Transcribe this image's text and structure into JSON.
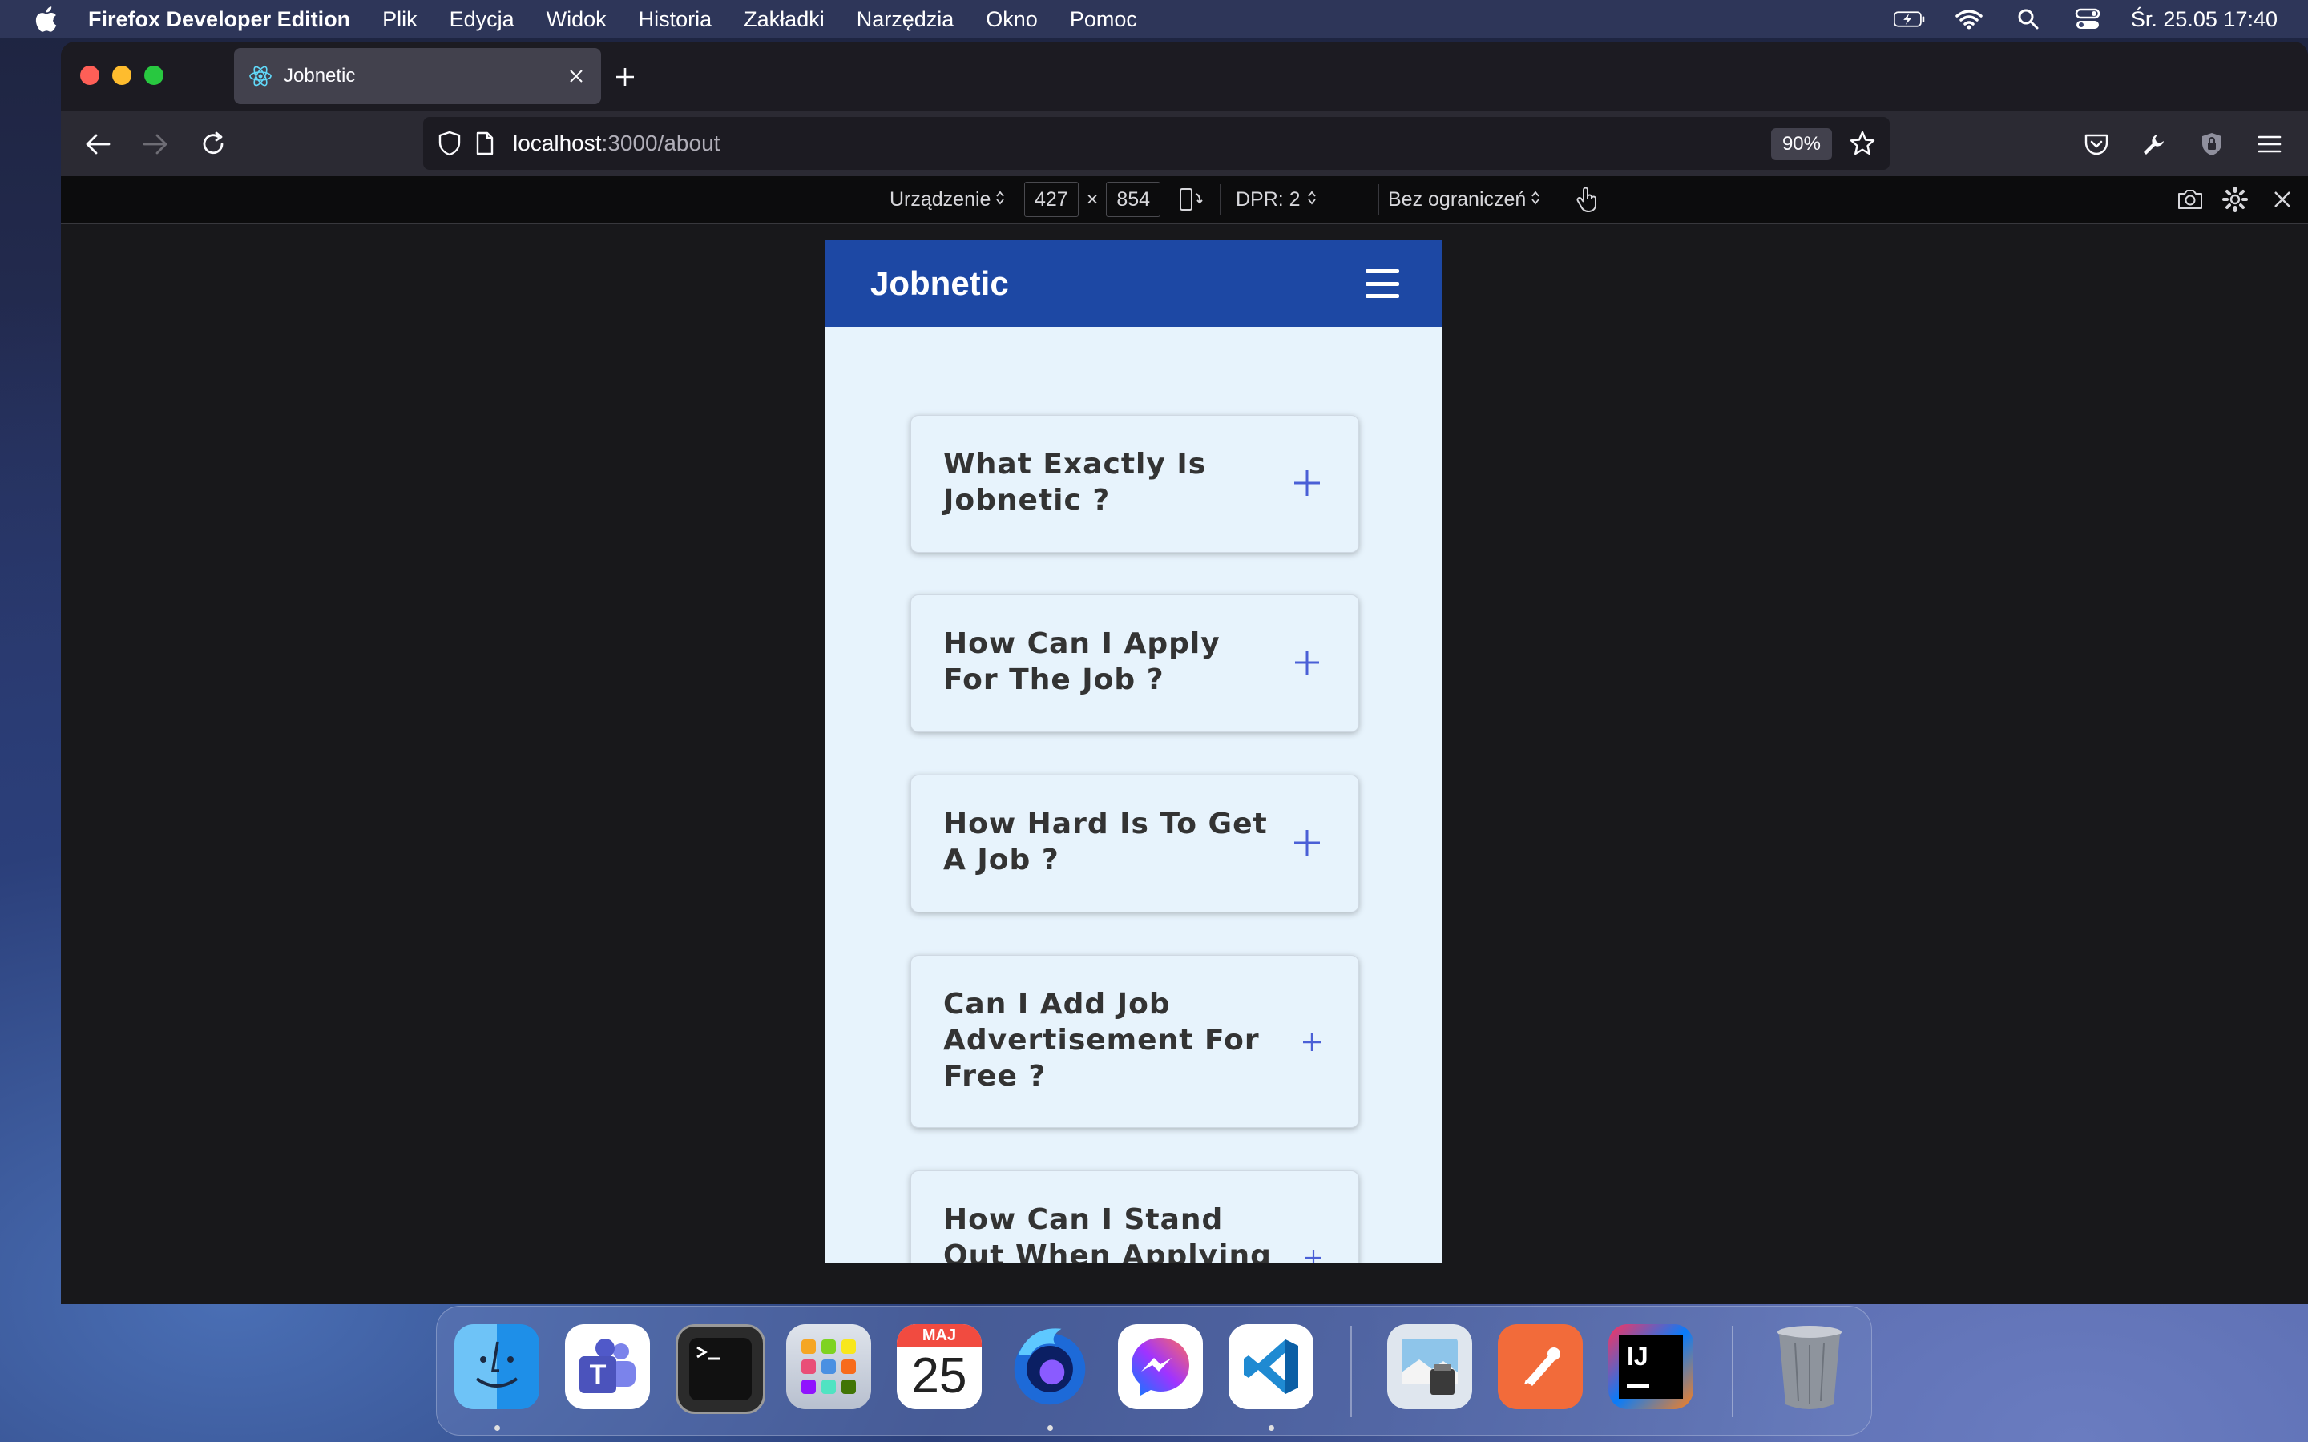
{
  "menubar": {
    "app_name": "Firefox Developer Edition",
    "items": [
      "Plik",
      "Edycja",
      "Widok",
      "Historia",
      "Zakładki",
      "Narzędzia",
      "Okno",
      "Pomoc"
    ],
    "clock": "Śr. 25.05  17:40"
  },
  "browser": {
    "tab_title": "Jobnetic",
    "url_host": "localhost",
    "url_path": ":3000/about",
    "zoom": "90%"
  },
  "rdm": {
    "device_label": "Urządzenie",
    "width": "427",
    "times": "×",
    "height": "854",
    "dpr": "DPR: 2",
    "throttle": "Bez ograniczeń"
  },
  "app": {
    "brand": "Jobnetic",
    "faq": [
      {
        "question": "What Exactly Is Jobnetic ?"
      },
      {
        "question": "How Can I Apply For The Job ?"
      },
      {
        "question": "How Hard Is To Get A Job ?"
      },
      {
        "question": "Can I Add Job Advertisement For Free ?"
      },
      {
        "question": "How Can I Stand Out When Applying For A Job ?"
      }
    ]
  },
  "dock": {
    "calendar_month": "MAJ",
    "calendar_day": "25",
    "apps": [
      "finder-icon",
      "teams-icon",
      "terminal-icon",
      "launchpad-icon",
      "calendar-icon",
      "firefox-icon",
      "messenger-icon",
      "vscode-icon",
      "preview-icon",
      "postman-icon",
      "intellij-icon",
      "trash-icon"
    ]
  },
  "colors": {
    "header_blue": "#1d48a4",
    "page_bg": "#e7f3fc",
    "plus_color": "#4a5fd6"
  }
}
